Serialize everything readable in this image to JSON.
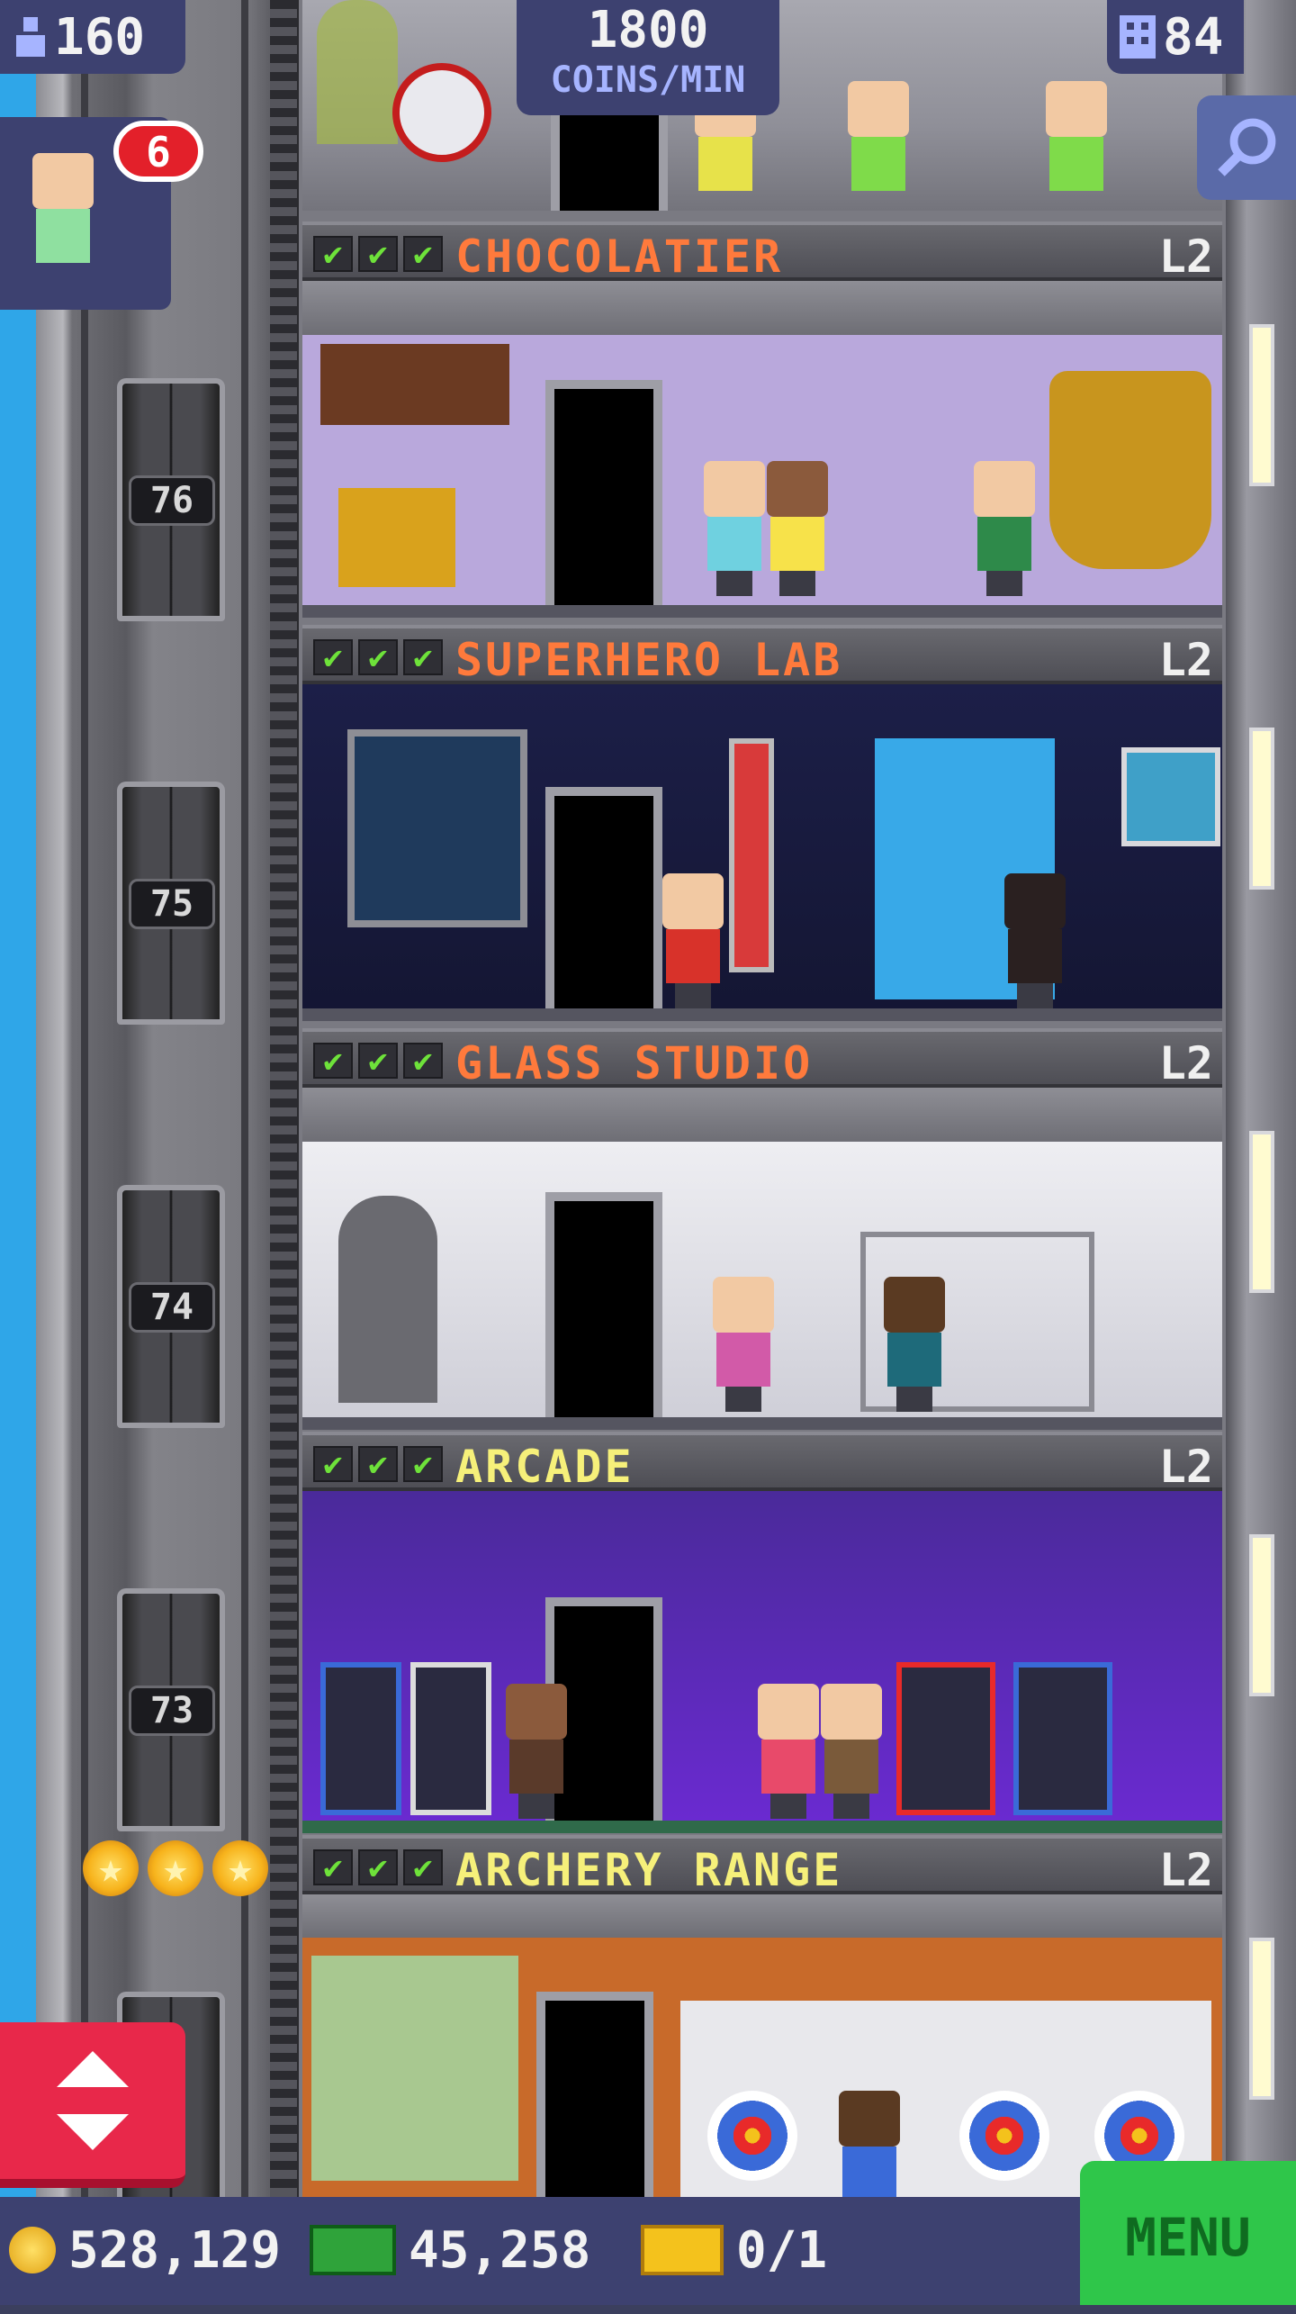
{
  "hud": {
    "population": "160",
    "coins_per_min_value": "1800",
    "coins_per_min_label": "COINS/MIN",
    "floors": "84",
    "visitor_badge": "6"
  },
  "elevator": {
    "floor_numbers": [
      "76",
      "75",
      "74",
      "73"
    ]
  },
  "floors": [
    {
      "name": "CHOCOLATIER",
      "level": "L2",
      "name_color": "#ff7a3c",
      "checks": "✔"
    },
    {
      "name": "SUPERHERO LAB",
      "level": "L2",
      "name_color": "#ff7a3c",
      "checks": "✔"
    },
    {
      "name": "GLASS STUDIO",
      "level": "L2",
      "name_color": "#ff7a3c",
      "checks": "✔"
    },
    {
      "name": "ARCADE",
      "level": "L2",
      "name_color": "#f6f07a",
      "checks": "✔"
    },
    {
      "name": "ARCHERY RANGE",
      "level": "L2",
      "name_color": "#f6f07a",
      "checks": "✔"
    }
  ],
  "footer": {
    "coins": "528,129",
    "bux": "45,258",
    "tickets": "0/1",
    "menu_label": "MENU"
  },
  "colors": {
    "hud_panel": "#3d4170",
    "menu_green": "#2fc64a",
    "elevator_red": "#e8284a"
  },
  "icons": [
    "population-icon",
    "building-icon",
    "search-icon",
    "elevator-arrows-icon",
    "coin-icon",
    "bux-icon",
    "ticket-icon",
    "star-icon",
    "check-icon"
  ]
}
